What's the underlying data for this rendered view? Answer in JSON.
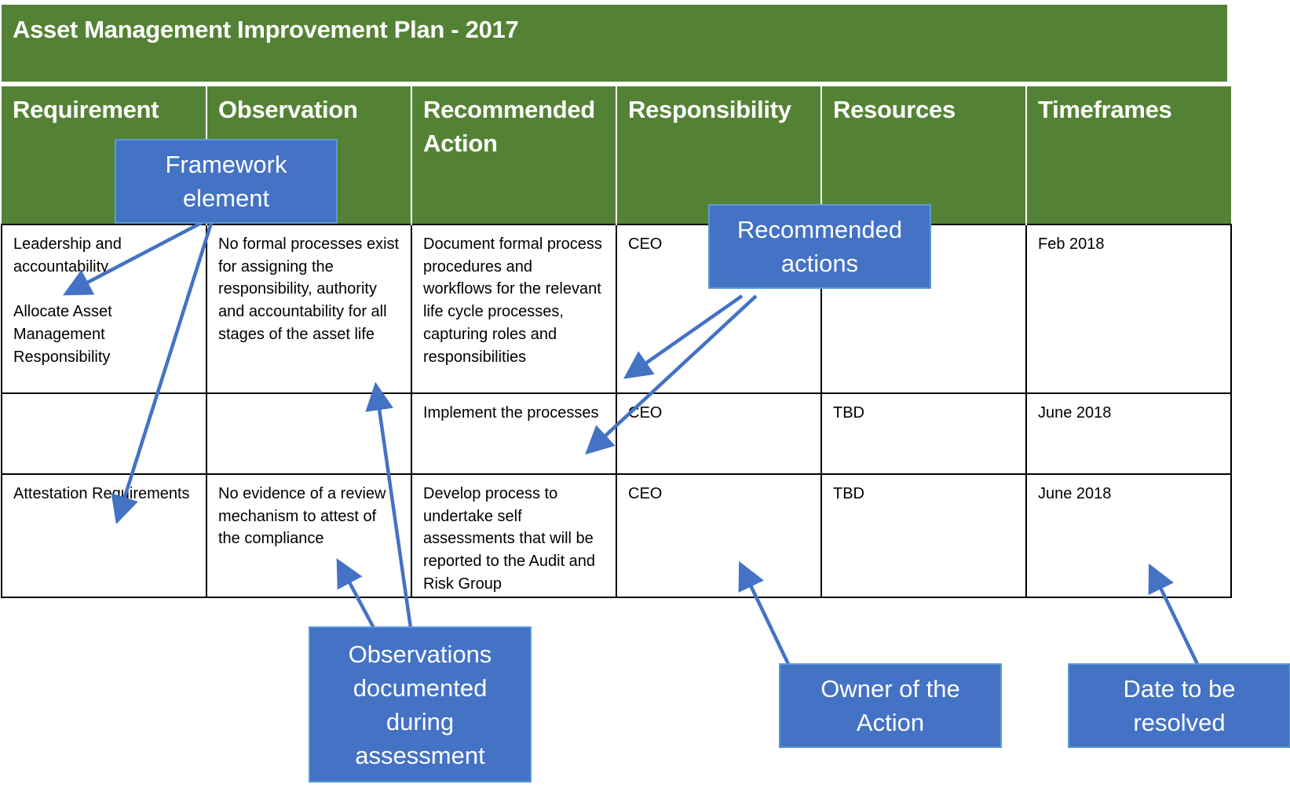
{
  "title": "Asset Management Improvement Plan - 2017",
  "table": {
    "headers": [
      "Requirement",
      "Observation",
      "Recommended Action",
      "Responsibility",
      "Resources",
      "Timeframes"
    ],
    "rows": [
      {
        "requirement": "Leadership and accountability\n\nAllocate Asset Management Responsibility",
        "observation": "No formal processes exist for assigning the responsibility, authority and accountability for all stages of the asset life",
        "action": "Document formal process procedures and workflows for the relevant life cycle processes, capturing roles and responsibilities",
        "responsibility": "CEO",
        "resources": "",
        "timeframe": "Feb 2018"
      },
      {
        "requirement": "",
        "observation": "",
        "action": "Implement the processes",
        "responsibility": "CEO",
        "resources": "TBD",
        "timeframe": "June 2018"
      },
      {
        "requirement": "Attestation Requirements",
        "observation": "No evidence of a review mechanism to attest of the compliance",
        "action": "Develop process to undertake self assessments that will be reported to the Audit and Risk Group",
        "responsibility": "CEO",
        "resources": "TBD",
        "timeframe": "June 2018"
      }
    ]
  },
  "callouts": {
    "framework": "Framework element",
    "recommended": "Recommended actions",
    "observations": "Observations documented during assessment",
    "owner": "Owner of the Action",
    "date": "Date to be resolved"
  },
  "colors": {
    "header_green": "#548235",
    "callout_blue": "#4472c4",
    "callout_border": "#5b9bd5"
  }
}
